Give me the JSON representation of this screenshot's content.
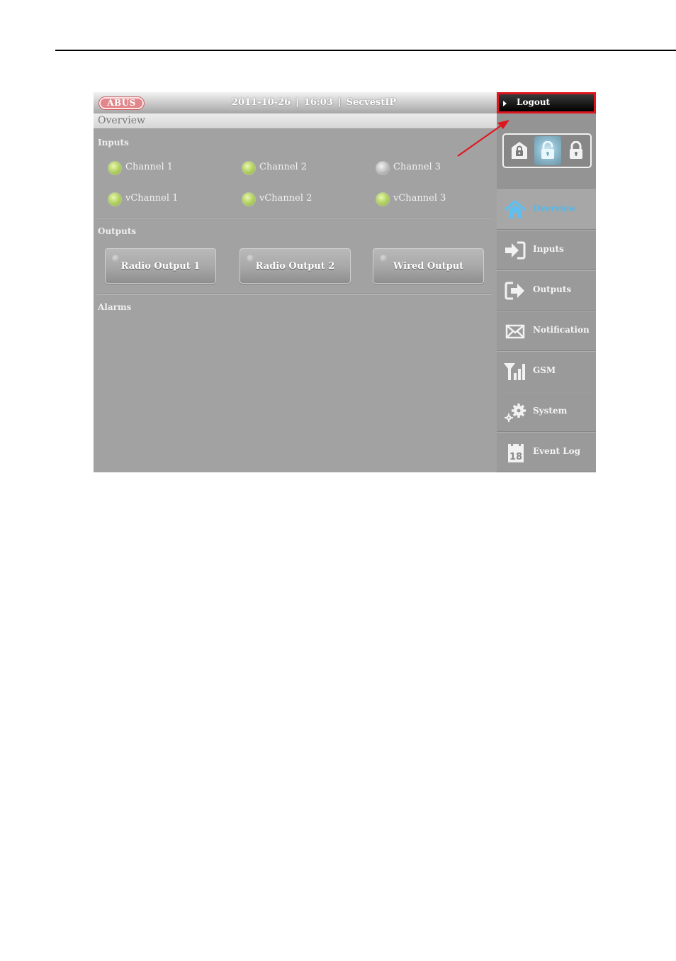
{
  "header": {
    "logo_text": "ABUS",
    "date": "2011-10-26",
    "separator": "|",
    "time": "16:03",
    "device": "SecvestIP"
  },
  "page_title": "Overview",
  "inputs": {
    "label": "Inputs",
    "items": [
      {
        "label": "Channel 1",
        "state": "green"
      },
      {
        "label": "Channel 2",
        "state": "green"
      },
      {
        "label": "Channel 3",
        "state": "gray"
      },
      {
        "label": "vChannel 1",
        "state": "green"
      },
      {
        "label": "vChannel 2",
        "state": "green"
      },
      {
        "label": "vChannel 3",
        "state": "green"
      }
    ]
  },
  "outputs": {
    "label": "Outputs",
    "items": [
      {
        "label": "Radio Output 1"
      },
      {
        "label": "Radio Output 2"
      },
      {
        "label": "Wired Output"
      }
    ]
  },
  "alarms": {
    "label": "Alarms"
  },
  "sidebar": {
    "logout_label": "Logout",
    "arm_modes": [
      {
        "icon": "house-lock-icon",
        "active": false
      },
      {
        "icon": "unlock-icon",
        "active": true
      },
      {
        "icon": "lock-icon",
        "active": false
      }
    ],
    "nav": [
      {
        "label": "Overview",
        "icon": "home-icon",
        "active": true
      },
      {
        "label": "Inputs",
        "icon": "input-arrow-icon",
        "active": false
      },
      {
        "label": "Outputs",
        "icon": "output-arrow-icon",
        "active": false
      },
      {
        "label": "Notification",
        "icon": "envelope-icon",
        "active": false
      },
      {
        "label": "GSM",
        "icon": "signal-icon",
        "active": false
      },
      {
        "label": "System",
        "icon": "gears-icon",
        "active": false
      },
      {
        "label": "Event Log",
        "icon": "calendar-icon",
        "active": false
      }
    ],
    "calendar_day": "18"
  },
  "colors": {
    "highlight_border": "#e0141c",
    "active_nav_text": "#55b8e8",
    "led_on": "#b9d66c",
    "led_off": "#c4c4c4"
  }
}
